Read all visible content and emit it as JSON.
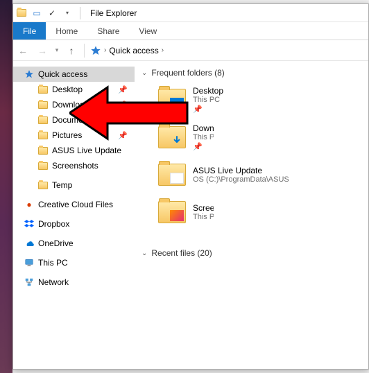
{
  "titlebar": {
    "title": "File Explorer"
  },
  "ribbon": {
    "file": "File",
    "home": "Home",
    "share": "Share",
    "view": "View"
  },
  "breadcrumb": {
    "root": "Quick access"
  },
  "nav": {
    "quick_access": "Quick access",
    "desktop": "Desktop",
    "downloads": "Downloads",
    "documents": "Documents",
    "pictures": "Pictures",
    "asus": "ASUS Live Update",
    "screenshots": "Screenshots",
    "temp": "Temp",
    "ccf": "Creative Cloud Files",
    "dropbox": "Dropbox",
    "onedrive": "OneDrive",
    "thispc": "This PC",
    "network": "Network"
  },
  "sections": {
    "frequent": "Frequent folders (8)",
    "recent": "Recent files (20)"
  },
  "tiles": {
    "desktop": {
      "name": "Desktop",
      "sub": "This PC"
    },
    "downloads": {
      "name": "Downloads",
      "sub": "This PC"
    },
    "asus": {
      "name": "ASUS Live Update",
      "sub": "OS (C:)\\ProgramData\\ASUS"
    },
    "screenshots": {
      "name": "Screenshots",
      "sub": "This PC"
    }
  }
}
